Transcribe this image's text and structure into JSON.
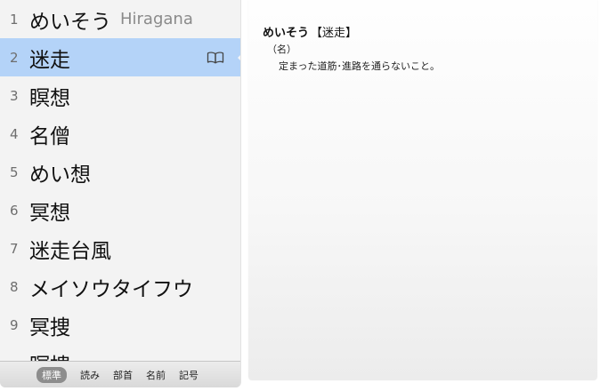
{
  "candidates": [
    {
      "num": "1",
      "text": "めいそう",
      "annotation": "Hiragana"
    },
    {
      "num": "2",
      "text": "迷走",
      "annotation": ""
    },
    {
      "num": "3",
      "text": "瞑想",
      "annotation": ""
    },
    {
      "num": "4",
      "text": "名僧",
      "annotation": ""
    },
    {
      "num": "5",
      "text": "めい想",
      "annotation": ""
    },
    {
      "num": "6",
      "text": "冥想",
      "annotation": ""
    },
    {
      "num": "7",
      "text": "迷走台風",
      "annotation": ""
    },
    {
      "num": "8",
      "text": "メイソウタイフウ",
      "annotation": ""
    },
    {
      "num": "9",
      "text": "冥捜",
      "annotation": ""
    },
    {
      "num": "",
      "text": "瞑捜",
      "annotation": ""
    }
  ],
  "selected_index": 2,
  "tabs": [
    {
      "label": "標準",
      "active": true
    },
    {
      "label": "読み",
      "active": false
    },
    {
      "label": "部首",
      "active": false
    },
    {
      "label": "名前",
      "active": false
    },
    {
      "label": "記号",
      "active": false
    }
  ],
  "definition": {
    "reading": "めいそう",
    "kanji": "【迷走】",
    "part_of_speech": "（名）",
    "meaning": "定まった道筋･進路を通らないこと。"
  },
  "icons": {
    "dictionary": "book-icon"
  },
  "colors": {
    "selection": "#b4d3f8",
    "active_tab": "#8d8d8d"
  }
}
